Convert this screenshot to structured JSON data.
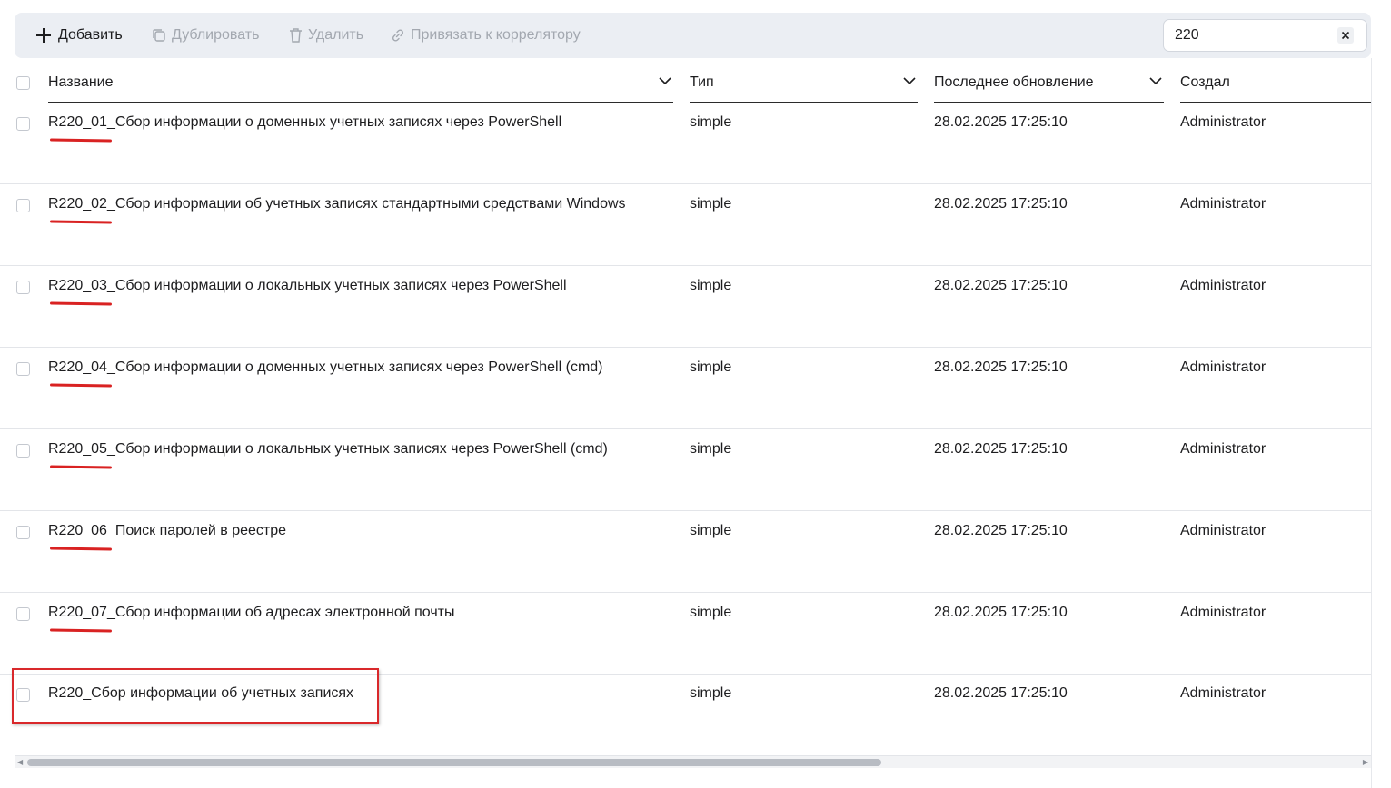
{
  "toolbar": {
    "add_label": "Добавить",
    "duplicate_label": "Дублировать",
    "delete_label": "Удалить",
    "bind_label": "Привязать к коррелятору"
  },
  "search": {
    "value": "220"
  },
  "table": {
    "columns": [
      {
        "label": "Название"
      },
      {
        "label": "Тип"
      },
      {
        "label": "Последнее обновление"
      },
      {
        "label": "Создал"
      }
    ],
    "rows": [
      {
        "name": "R220_01_Сбор информации о доменных учетных записях через PowerShell",
        "type": "simple",
        "updated": "28.02.2025 17:25:10",
        "author": "Administrator"
      },
      {
        "name": "R220_02_Сбор информации об учетных записях стандартными средствами Windows",
        "type": "simple",
        "updated": "28.02.2025 17:25:10",
        "author": "Administrator"
      },
      {
        "name": "R220_03_Сбор информации о локальных учетных записях через PowerShell",
        "type": "simple",
        "updated": "28.02.2025 17:25:10",
        "author": "Administrator"
      },
      {
        "name": "R220_04_Сбор информации о доменных учетных записях через PowerShell (cmd)",
        "type": "simple",
        "updated": "28.02.2025 17:25:10",
        "author": "Administrator"
      },
      {
        "name": "R220_05_Сбор информации о локальных учетных записях через PowerShell (cmd)",
        "type": "simple",
        "updated": "28.02.2025 17:25:10",
        "author": "Administrator"
      },
      {
        "name": "R220_06_Поиск паролей в реестре",
        "type": "simple",
        "updated": "28.02.2025 17:25:10",
        "author": "Administrator"
      },
      {
        "name": "R220_07_Сбор информации об адресах электронной почты",
        "type": "simple",
        "updated": "28.02.2025 17:25:10",
        "author": "Administrator"
      },
      {
        "name": "R220_Сбор информации об учетных записях",
        "type": "simple",
        "updated": "28.02.2025 17:25:10",
        "author": "Administrator"
      }
    ]
  },
  "colors": {
    "toolbar_bg": "#ebeef3",
    "annotation_red": "#d92222",
    "disabled_text": "#a3a8b0"
  }
}
